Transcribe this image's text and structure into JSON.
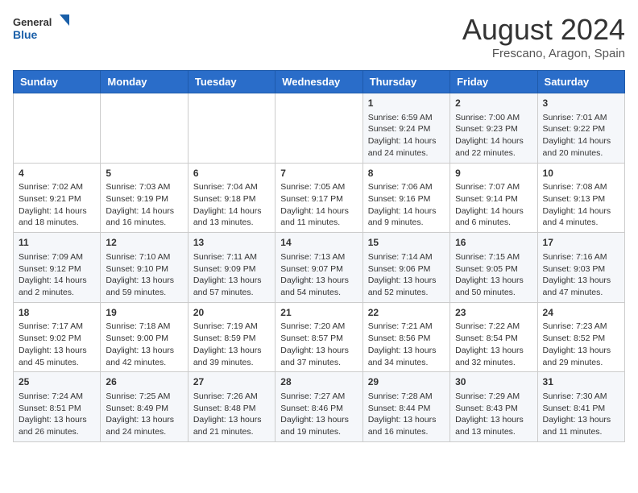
{
  "header": {
    "logo_general": "General",
    "logo_blue": "Blue",
    "month_year": "August 2024",
    "location": "Frescano, Aragon, Spain"
  },
  "weekdays": [
    "Sunday",
    "Monday",
    "Tuesday",
    "Wednesday",
    "Thursday",
    "Friday",
    "Saturday"
  ],
  "weeks": [
    [
      {
        "day": "",
        "info": ""
      },
      {
        "day": "",
        "info": ""
      },
      {
        "day": "",
        "info": ""
      },
      {
        "day": "",
        "info": ""
      },
      {
        "day": "1",
        "info": "Sunrise: 6:59 AM\nSunset: 9:24 PM\nDaylight: 14 hours\nand 24 minutes."
      },
      {
        "day": "2",
        "info": "Sunrise: 7:00 AM\nSunset: 9:23 PM\nDaylight: 14 hours\nand 22 minutes."
      },
      {
        "day": "3",
        "info": "Sunrise: 7:01 AM\nSunset: 9:22 PM\nDaylight: 14 hours\nand 20 minutes."
      }
    ],
    [
      {
        "day": "4",
        "info": "Sunrise: 7:02 AM\nSunset: 9:21 PM\nDaylight: 14 hours\nand 18 minutes."
      },
      {
        "day": "5",
        "info": "Sunrise: 7:03 AM\nSunset: 9:19 PM\nDaylight: 14 hours\nand 16 minutes."
      },
      {
        "day": "6",
        "info": "Sunrise: 7:04 AM\nSunset: 9:18 PM\nDaylight: 14 hours\nand 13 minutes."
      },
      {
        "day": "7",
        "info": "Sunrise: 7:05 AM\nSunset: 9:17 PM\nDaylight: 14 hours\nand 11 minutes."
      },
      {
        "day": "8",
        "info": "Sunrise: 7:06 AM\nSunset: 9:16 PM\nDaylight: 14 hours\nand 9 minutes."
      },
      {
        "day": "9",
        "info": "Sunrise: 7:07 AM\nSunset: 9:14 PM\nDaylight: 14 hours\nand 6 minutes."
      },
      {
        "day": "10",
        "info": "Sunrise: 7:08 AM\nSunset: 9:13 PM\nDaylight: 14 hours\nand 4 minutes."
      }
    ],
    [
      {
        "day": "11",
        "info": "Sunrise: 7:09 AM\nSunset: 9:12 PM\nDaylight: 14 hours\nand 2 minutes."
      },
      {
        "day": "12",
        "info": "Sunrise: 7:10 AM\nSunset: 9:10 PM\nDaylight: 13 hours\nand 59 minutes."
      },
      {
        "day": "13",
        "info": "Sunrise: 7:11 AM\nSunset: 9:09 PM\nDaylight: 13 hours\nand 57 minutes."
      },
      {
        "day": "14",
        "info": "Sunrise: 7:13 AM\nSunset: 9:07 PM\nDaylight: 13 hours\nand 54 minutes."
      },
      {
        "day": "15",
        "info": "Sunrise: 7:14 AM\nSunset: 9:06 PM\nDaylight: 13 hours\nand 52 minutes."
      },
      {
        "day": "16",
        "info": "Sunrise: 7:15 AM\nSunset: 9:05 PM\nDaylight: 13 hours\nand 50 minutes."
      },
      {
        "day": "17",
        "info": "Sunrise: 7:16 AM\nSunset: 9:03 PM\nDaylight: 13 hours\nand 47 minutes."
      }
    ],
    [
      {
        "day": "18",
        "info": "Sunrise: 7:17 AM\nSunset: 9:02 PM\nDaylight: 13 hours\nand 45 minutes."
      },
      {
        "day": "19",
        "info": "Sunrise: 7:18 AM\nSunset: 9:00 PM\nDaylight: 13 hours\nand 42 minutes."
      },
      {
        "day": "20",
        "info": "Sunrise: 7:19 AM\nSunset: 8:59 PM\nDaylight: 13 hours\nand 39 minutes."
      },
      {
        "day": "21",
        "info": "Sunrise: 7:20 AM\nSunset: 8:57 PM\nDaylight: 13 hours\nand 37 minutes."
      },
      {
        "day": "22",
        "info": "Sunrise: 7:21 AM\nSunset: 8:56 PM\nDaylight: 13 hours\nand 34 minutes."
      },
      {
        "day": "23",
        "info": "Sunrise: 7:22 AM\nSunset: 8:54 PM\nDaylight: 13 hours\nand 32 minutes."
      },
      {
        "day": "24",
        "info": "Sunrise: 7:23 AM\nSunset: 8:52 PM\nDaylight: 13 hours\nand 29 minutes."
      }
    ],
    [
      {
        "day": "25",
        "info": "Sunrise: 7:24 AM\nSunset: 8:51 PM\nDaylight: 13 hours\nand 26 minutes."
      },
      {
        "day": "26",
        "info": "Sunrise: 7:25 AM\nSunset: 8:49 PM\nDaylight: 13 hours\nand 24 minutes."
      },
      {
        "day": "27",
        "info": "Sunrise: 7:26 AM\nSunset: 8:48 PM\nDaylight: 13 hours\nand 21 minutes."
      },
      {
        "day": "28",
        "info": "Sunrise: 7:27 AM\nSunset: 8:46 PM\nDaylight: 13 hours\nand 19 minutes."
      },
      {
        "day": "29",
        "info": "Sunrise: 7:28 AM\nSunset: 8:44 PM\nDaylight: 13 hours\nand 16 minutes."
      },
      {
        "day": "30",
        "info": "Sunrise: 7:29 AM\nSunset: 8:43 PM\nDaylight: 13 hours\nand 13 minutes."
      },
      {
        "day": "31",
        "info": "Sunrise: 7:30 AM\nSunset: 8:41 PM\nDaylight: 13 hours\nand 11 minutes."
      }
    ]
  ]
}
